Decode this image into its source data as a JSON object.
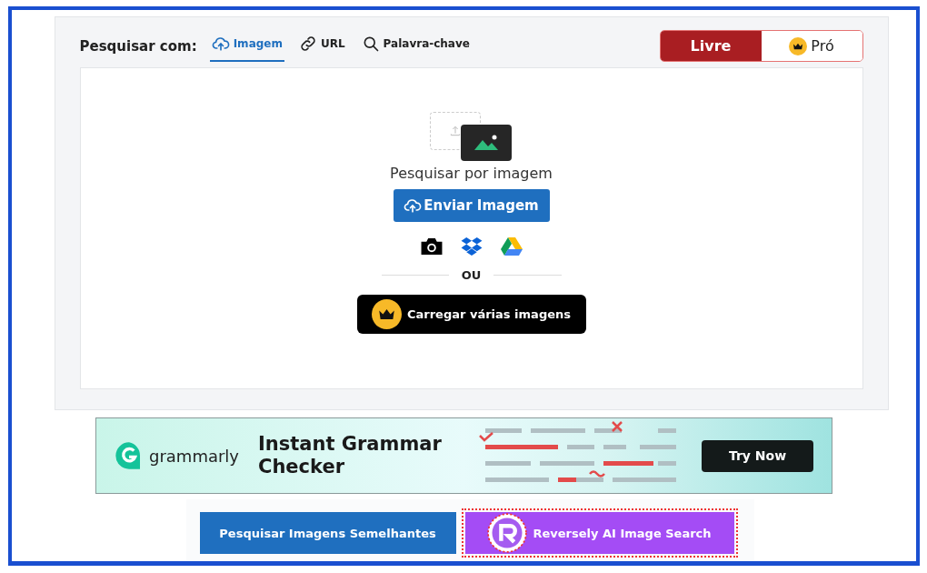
{
  "search_with": {
    "label": "Pesquisar com:",
    "tabs": [
      {
        "label": "Imagem",
        "kind": "upload",
        "selected": true
      },
      {
        "label": "URL",
        "kind": "link",
        "selected": false
      },
      {
        "label": "Palavra-chave",
        "kind": "search",
        "selected": false
      }
    ]
  },
  "plans": [
    {
      "label": "Livre",
      "premium": false,
      "selected": true
    },
    {
      "label": "Pró",
      "premium": true,
      "selected": false
    }
  ],
  "upload": {
    "title": "Pesquisar por imagem",
    "button": "Enviar Imagem",
    "divider": "OU",
    "bulk_button": "Carregar várias imagens"
  },
  "ad": {
    "brand": "grammarly",
    "headline": "Instant Grammar Checker",
    "cta": "Try Now"
  },
  "actions": [
    {
      "label": "Pesquisar Imagens Semelhantes",
      "kind": "primary"
    },
    {
      "label": "Reversely AI Image Search",
      "kind": "promo"
    }
  ]
}
